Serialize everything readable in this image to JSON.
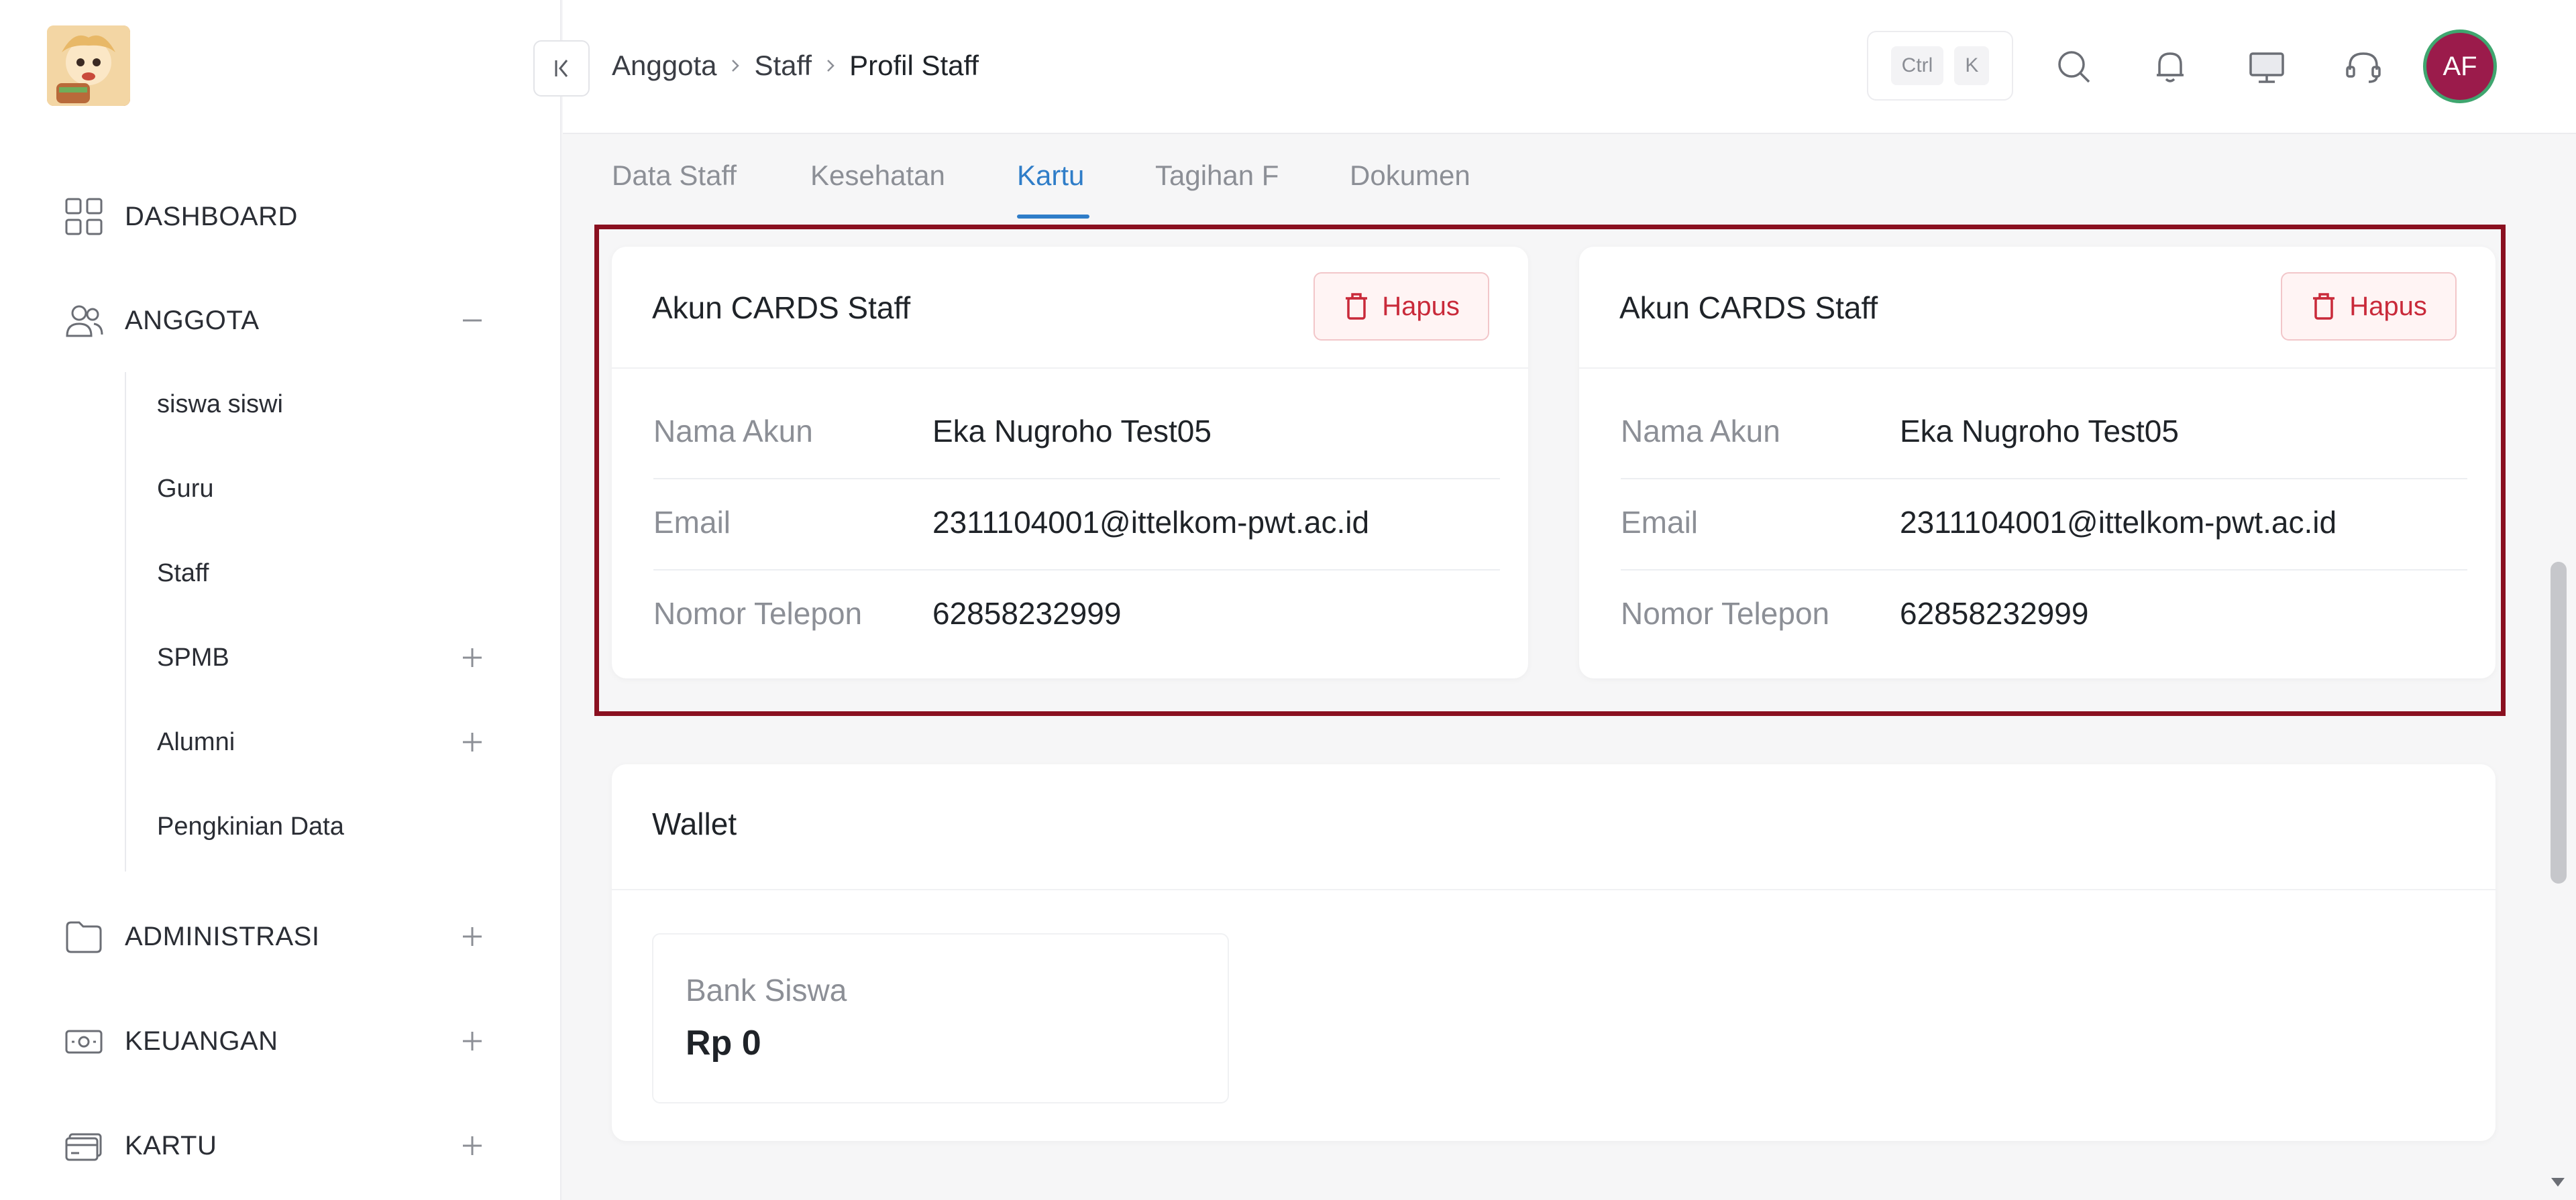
{
  "sidebar": {
    "logo_name": "app-logo",
    "items": [
      {
        "label": "DASHBOARD",
        "icon": "grid-icon"
      },
      {
        "label": "ANGGOTA",
        "icon": "users-icon",
        "toggle": "collapse"
      },
      {
        "label": "ADMINISTRASI",
        "icon": "folder-icon",
        "toggle": "expand"
      },
      {
        "label": "KEUANGAN",
        "icon": "money-icon",
        "toggle": "expand"
      },
      {
        "label": "KARTU",
        "icon": "card-icon",
        "toggle": "expand"
      }
    ],
    "anggota_sub": [
      {
        "label": "siswa siswi"
      },
      {
        "label": "Guru"
      },
      {
        "label": "Staff"
      },
      {
        "label": "SPMB",
        "toggle": "expand"
      },
      {
        "label": "Alumni",
        "toggle": "expand"
      },
      {
        "label": "Pengkinian Data"
      }
    ]
  },
  "header": {
    "breadcrumb": [
      "Anggota",
      "Staff",
      "Profil Staff"
    ],
    "shortcut": {
      "key1": "Ctrl",
      "key2": "K"
    },
    "avatar_initials": "AF",
    "icons": [
      "search-icon",
      "bell-icon",
      "monitor-icon",
      "headset-icon"
    ]
  },
  "tabs": [
    "Data Staff",
    "Kesehatan",
    "Kartu",
    "Tagihan F",
    "Dokumen"
  ],
  "active_tab": "Kartu",
  "cards": [
    {
      "title": "Akun CARDS Staff",
      "delete_label": "Hapus",
      "fields": [
        {
          "label": "Nama Akun",
          "value": "Eka Nugroho Test05"
        },
        {
          "label": "Email",
          "value": "2311104001@ittelkom-pwt.ac.id"
        },
        {
          "label": "Nomor Telepon",
          "value": "62858232999"
        }
      ]
    },
    {
      "title": "Akun CARDS Staff",
      "delete_label": "Hapus",
      "fields": [
        {
          "label": "Nama Akun",
          "value": "Eka Nugroho Test05"
        },
        {
          "label": "Email",
          "value": "2311104001@ittelkom-pwt.ac.id"
        },
        {
          "label": "Nomor Telepon",
          "value": "62858232999"
        }
      ]
    }
  ],
  "wallet": {
    "title": "Wallet",
    "bank_label": "Bank Siswa",
    "bank_value": "Rp 0"
  },
  "colors": {
    "accent": "#2f7dc8",
    "danger": "#c92a3a",
    "highlight": "#8a1020",
    "avatar_bg": "#9b1b4b"
  }
}
